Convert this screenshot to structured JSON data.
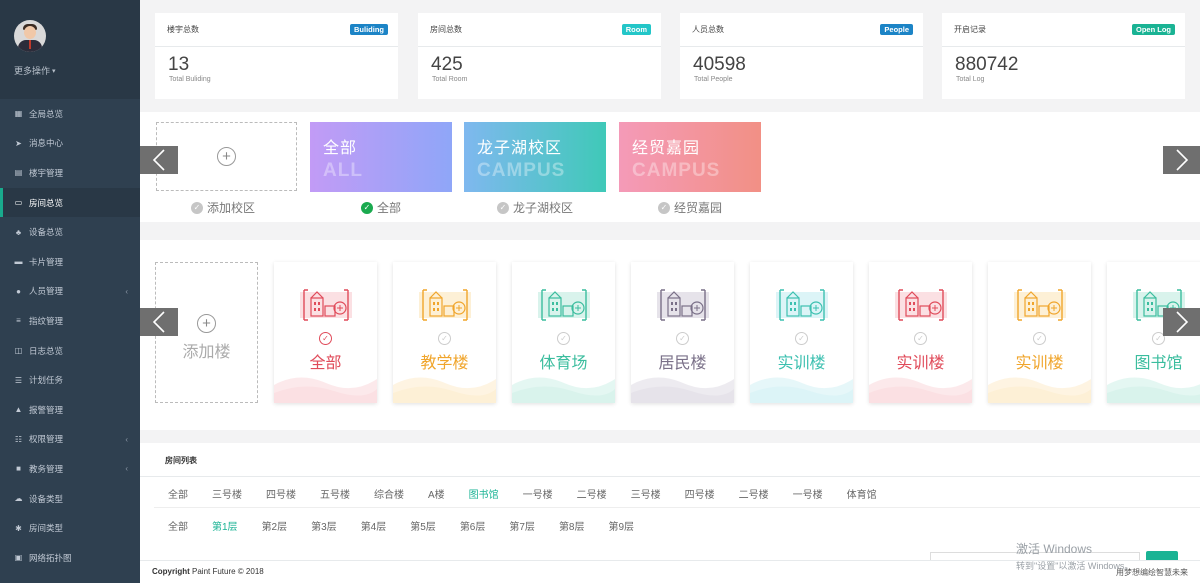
{
  "sidebar": {
    "more_ops": "更多操作",
    "items": [
      {
        "label": "全局总览",
        "icon": "grid-icon",
        "glyph": "▦"
      },
      {
        "label": "消息中心",
        "icon": "paper-plane-icon",
        "glyph": "➤"
      },
      {
        "label": "楼宇管理",
        "icon": "document-icon",
        "glyph": "▤"
      },
      {
        "label": "房间总览",
        "icon": "monitor-icon",
        "glyph": "▭"
      },
      {
        "label": "设备总览",
        "icon": "sitemap-icon",
        "glyph": "♣"
      },
      {
        "label": "卡片管理",
        "icon": "card-icon",
        "glyph": "▬"
      },
      {
        "label": "人员管理",
        "icon": "users-icon",
        "glyph": "●"
      },
      {
        "label": "指纹管理",
        "icon": "list-icon",
        "glyph": "≡"
      },
      {
        "label": "日志总览",
        "icon": "log-icon",
        "glyph": "◫"
      },
      {
        "label": "计划任务",
        "icon": "tasks-icon",
        "glyph": "☰"
      },
      {
        "label": "报警管理",
        "icon": "warning-icon",
        "glyph": "▲"
      },
      {
        "label": "权限管理",
        "icon": "sliders-icon",
        "glyph": "☷"
      },
      {
        "label": "教务管理",
        "icon": "cubes-icon",
        "glyph": "■"
      },
      {
        "label": "设备类型",
        "icon": "cloud-icon",
        "glyph": "☁"
      },
      {
        "label": "房间类型",
        "icon": "asterisk-icon",
        "glyph": "✱"
      },
      {
        "label": "网络拓扑图",
        "icon": "network-icon",
        "glyph": "▣"
      }
    ]
  },
  "stats": [
    {
      "title": "楼宇总数",
      "badge": "Buliding",
      "badge_color": "#1c84c6",
      "value": "13",
      "sub": "Total Buliding"
    },
    {
      "title": "房间总数",
      "badge": "Room",
      "badge_color": "#23c6c8",
      "value": "425",
      "sub": "Total Room"
    },
    {
      "title": "人员总数",
      "badge": "People",
      "badge_color": "#1c84c6",
      "value": "40598",
      "sub": "Total People"
    },
    {
      "title": "开启记录",
      "badge": "Open Log",
      "badge_color": "#1ab394",
      "value": "880742",
      "sub": "Total Log"
    }
  ],
  "campus": {
    "add_label": "添加校区",
    "cards": [
      {
        "cn": "全部",
        "en": "ALL",
        "label": "全部",
        "gradient": "linear-gradient(90deg,#c29bf6,#8fa6f8)"
      },
      {
        "cn": "龙子湖校区",
        "en": "CAMPUS",
        "label": "龙子湖校区",
        "gradient": "linear-gradient(90deg,#7fb8ef,#3fc9b8)"
      },
      {
        "cn": "经贸嘉园",
        "en": "CAMPUS",
        "label": "经贸嘉园",
        "gradient": "linear-gradient(90deg,#f49ab8,#f29085)"
      }
    ]
  },
  "buildings": {
    "add_label": "添加楼",
    "cards": [
      {
        "name": "全部",
        "color": "#e04b5a",
        "light": "#fbe0e3"
      },
      {
        "name": "教学楼",
        "color": "#f0a52c",
        "light": "#fdf0d6"
      },
      {
        "name": "体育场",
        "color": "#3bbd9e",
        "light": "#d9f3ec"
      },
      {
        "name": "居民楼",
        "color": "#7a7088",
        "light": "#e6e3ea"
      },
      {
        "name": "实训楼",
        "color": "#3cc0b0",
        "light": "#dcf4f7"
      },
      {
        "name": "实训楼",
        "color": "#e04b5a",
        "light": "#fbe0e3"
      },
      {
        "name": "实训楼",
        "color": "#f0a52c",
        "light": "#fdf0d6"
      },
      {
        "name": "图书馆",
        "color": "#3bbd9e",
        "light": "#d9f3ec"
      }
    ]
  },
  "room_list": {
    "title": "房间列表",
    "buildings": [
      "全部",
      "三号楼",
      "四号楼",
      "五号楼",
      "综合楼",
      "A楼",
      "图书馆",
      "一号楼",
      "二号楼",
      "三号楼",
      "四号楼",
      "二号楼",
      "一号楼",
      "体育馆"
    ],
    "selected_building": "图书馆",
    "floors": [
      "全部",
      "第1层",
      "第2层",
      "第3层",
      "第4层",
      "第5层",
      "第6层",
      "第7层",
      "第8层",
      "第9层"
    ],
    "selected_floor": "第1层"
  },
  "footer": {
    "copyright_bold": "Copyright",
    "copyright_rest": " Paint Future © 2018",
    "right": "用梦想编绘智慧未来"
  },
  "windows_activation": {
    "line1": "激活 Windows",
    "line2": "转到\"设置\"以激活 Windows。"
  },
  "colors": {
    "sidebar_bg": "#2f4050",
    "accent": "#1ab394"
  }
}
